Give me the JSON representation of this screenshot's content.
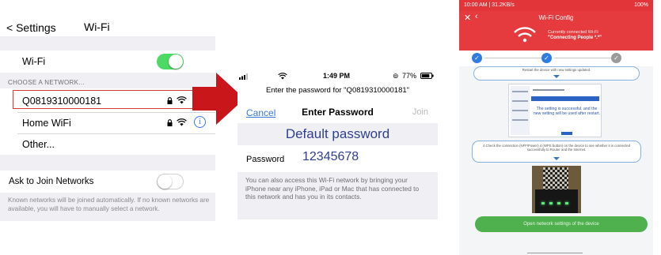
{
  "settings": {
    "back_label": "< Settings",
    "title": "Wi-Fi",
    "wifi_row_label": "Wi-Fi",
    "choose_network_header": "CHOOSE A NETWORK...",
    "networks": [
      {
        "name": "Q0819310000181",
        "locked": true,
        "highlighted": true
      },
      {
        "name": "Home WiFi",
        "locked": true,
        "highlighted": false
      }
    ],
    "other_label": "Other...",
    "ask_join_label": "Ask to Join Networks",
    "footer_note": "Known networks will be joined automatically. If no known networks are available, you will have to manually select a network.",
    "wifi_toggle_on": true,
    "ask_join_toggle_on": false,
    "toggle_on_color": "#4cd964",
    "highlight_color": "#d33a3a",
    "info_icon": "info-circle-icon",
    "lock_icon": "lock-icon",
    "wifi_icon": "wifi-icon"
  },
  "arrow": {
    "color": "#c8161b",
    "icon": "right-arrow-icon"
  },
  "password_dialog": {
    "time": "1:49 PM",
    "battery": "77%",
    "prompt": "Enter the password for \"Q0819310000181\"",
    "cancel_label": "Cancel",
    "heading": "Enter Password",
    "join_label": "Join",
    "default_password_label": "Default password",
    "password_field_label": "Password",
    "password_value": "12345678",
    "description": "You can also access this Wi-Fi network by bringing your iPhone near any iPhone, iPad or Mac that has connected to this network and has you in its contacts.",
    "accent_color": "#3a7be0",
    "annotation_color": "#2f3f8f"
  },
  "config_app": {
    "status_time": "10:00 AM | 31.2KB/s",
    "status_right": "100%",
    "title": "Wi-Fi Config",
    "close_icon": "close-icon",
    "back_icon": "back-icon",
    "connection_label": "Currently connected Wi-Fi",
    "connection_name": "\"Connecting People *.*\"",
    "brand_color": "#e53b3f",
    "card_top_text": "Restart the device with new settings updated.",
    "success_text": "The setting is successful, and the new setting will be used after restart.",
    "card_bottom_text": "4.Check the connection (NFF/Power) 4 (WPS button) on the device to see whether it is connected successfully to Router and the Internet.",
    "open_button_label": "Open network settings of the device",
    "button_color": "#4fb04e"
  }
}
